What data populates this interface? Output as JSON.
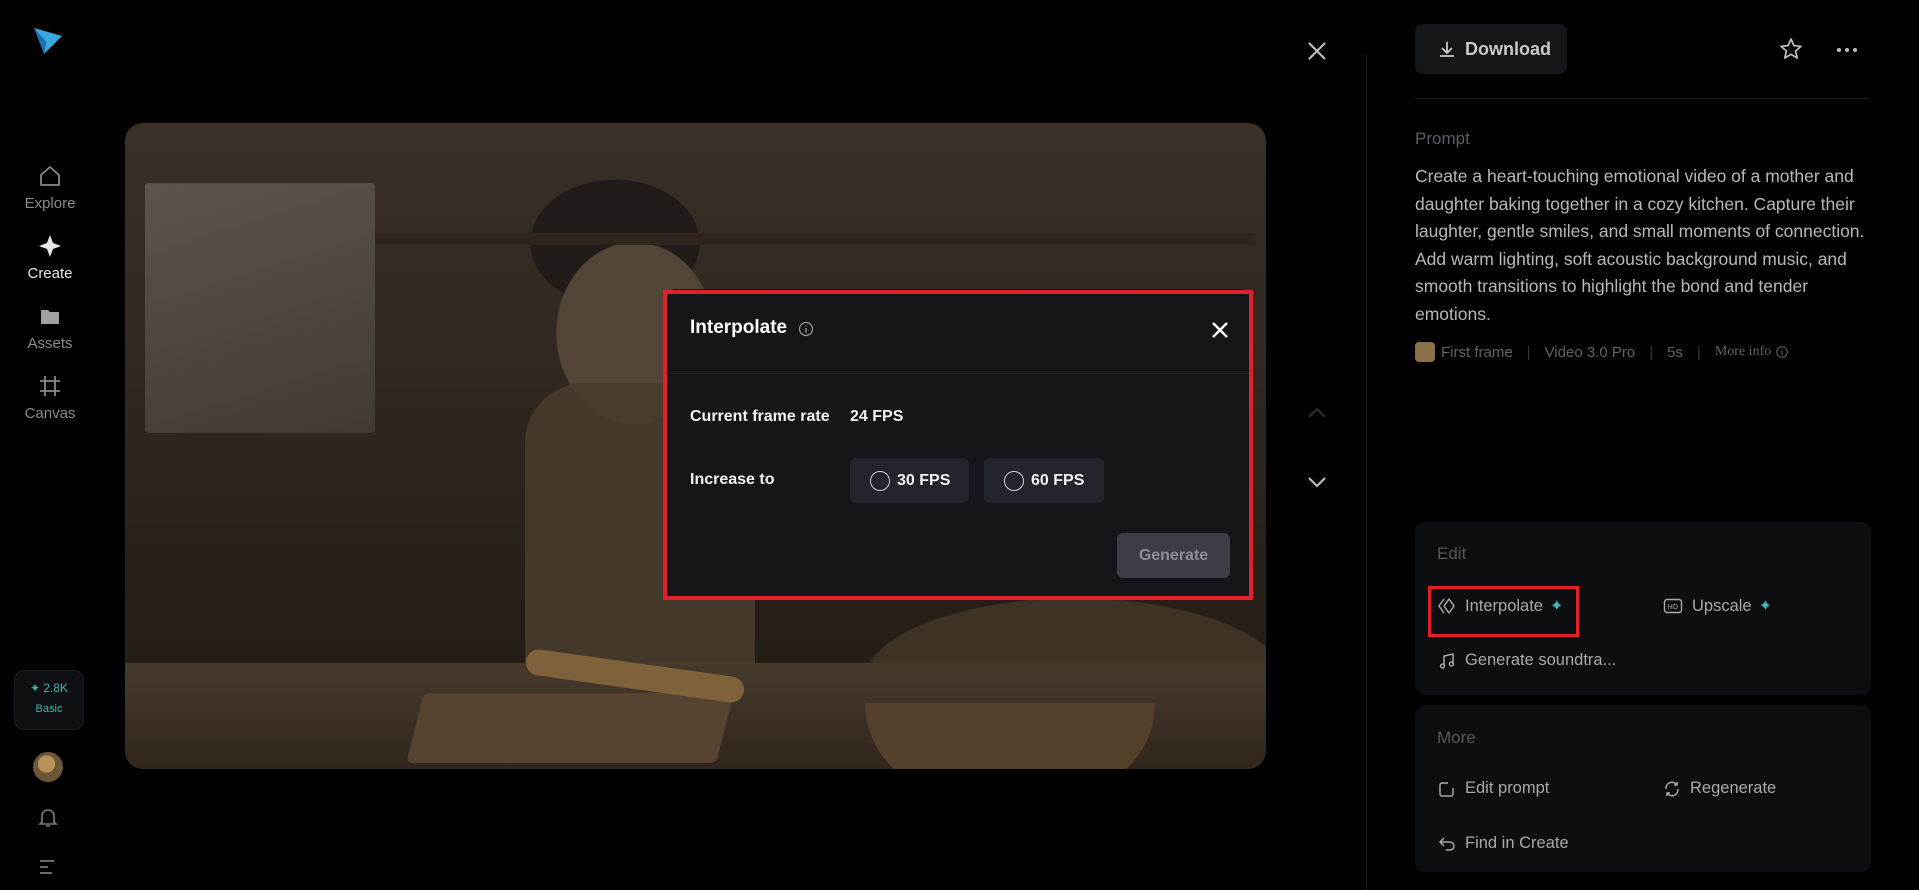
{
  "nav": {
    "items": [
      {
        "label": "Explore",
        "icon": "home-icon"
      },
      {
        "label": "Create",
        "icon": "sparkle-icon"
      },
      {
        "label": "Assets",
        "icon": "folder-icon"
      },
      {
        "label": "Canvas",
        "icon": "canvas-icon"
      }
    ],
    "credits": "✦ 2.8K",
    "plan": "Basic"
  },
  "modal": {
    "title": "Interpolate",
    "current_label": "Current frame rate",
    "current_value": "24 FPS",
    "increase_label": "Increase to",
    "options": [
      "30 FPS",
      "60 FPS"
    ],
    "generate_label": "Generate"
  },
  "panel": {
    "download_label": "Download",
    "prompt_heading": "Prompt",
    "prompt_text": "Create a heart-touching emotional video of a mother and daughter baking together in a cozy kitchen. Capture their laughter, gentle smiles, and small moments of connection. Add warm lighting, soft acoustic background music, and smooth transitions to highlight the bond and tender emotions.",
    "meta": {
      "frame": "First frame",
      "model": "Video 3.0 Pro",
      "duration": "5s",
      "more_info": "More info"
    },
    "edit": {
      "heading": "Edit",
      "interpolate": "Interpolate",
      "upscale": "Upscale",
      "soundtrack": "Generate soundtra..."
    },
    "more": {
      "heading": "More",
      "edit_prompt": "Edit prompt",
      "regenerate": "Regenerate",
      "find_in_create": "Find in Create"
    }
  },
  "colors": {
    "accent": "#3fb7b3",
    "highlight": "#e0202a",
    "modal_bg": "#14161a"
  }
}
